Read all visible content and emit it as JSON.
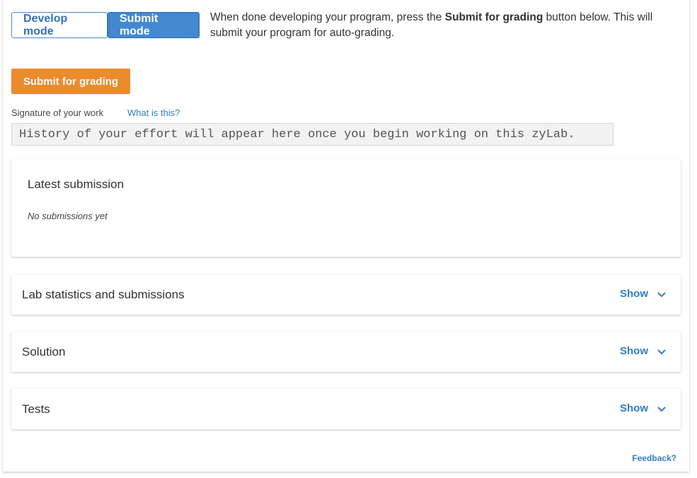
{
  "mode": {
    "develop_label": "Develop mode",
    "submit_label": "Submit mode",
    "desc_before": "When done developing your program, press the ",
    "desc_bold": "Submit for grading",
    "desc_after": " button below. This will submit your program for auto-grading."
  },
  "grading": {
    "button_label": "Submit for grading"
  },
  "signature": {
    "label": "Signature of your work",
    "help_link": "What is this?",
    "placeholder_text": "History of your effort will appear here once you begin working on this zyLab."
  },
  "latest": {
    "title": "Latest submission",
    "empty_text": "No submissions yet"
  },
  "sections": [
    {
      "title": "Lab statistics and submissions",
      "toggle": "Show",
      "icon": "chevron-down-icon"
    },
    {
      "title": "Solution",
      "toggle": "Show",
      "icon": "chevron-down-icon"
    },
    {
      "title": "Tests",
      "toggle": "Show",
      "icon": "chevron-down-icon"
    }
  ],
  "footer": {
    "feedback": "Feedback?"
  },
  "colors": {
    "accent_blue": "#4289d1",
    "link_blue": "#2f7dc5",
    "grade_orange": "#ec8b2e"
  }
}
